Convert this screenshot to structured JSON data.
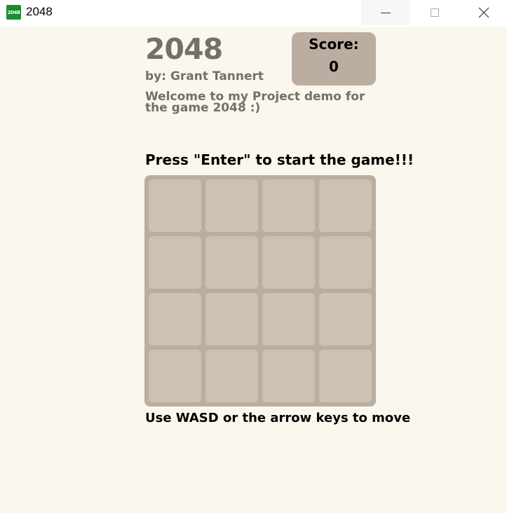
{
  "window": {
    "icon_text": "2048",
    "title": "2048",
    "minimize_icon": "minimize-icon",
    "maximize_icon": "maximize-icon",
    "close_icon": "close-icon"
  },
  "header": {
    "title": "2048",
    "author": "by: Grant Tannert",
    "welcome": "Welcome to my Project demo for the game 2048 :)"
  },
  "score": {
    "label": "Score:",
    "value": "0"
  },
  "start_message": "Press \"Enter\" to start the game!!!",
  "board": {
    "rows": 4,
    "cols": 4,
    "tiles": [
      [
        "",
        "",
        "",
        ""
      ],
      [
        "",
        "",
        "",
        ""
      ],
      [
        "",
        "",
        "",
        ""
      ],
      [
        "",
        "",
        "",
        ""
      ]
    ]
  },
  "controls_message": "Use WASD or the arrow keys to move",
  "colors": {
    "background": "#faf7ef",
    "board": "#bbada0",
    "empty_cell": "#cdc1b4",
    "title_text": "#776e65",
    "app_icon": "#1a8e2e"
  }
}
